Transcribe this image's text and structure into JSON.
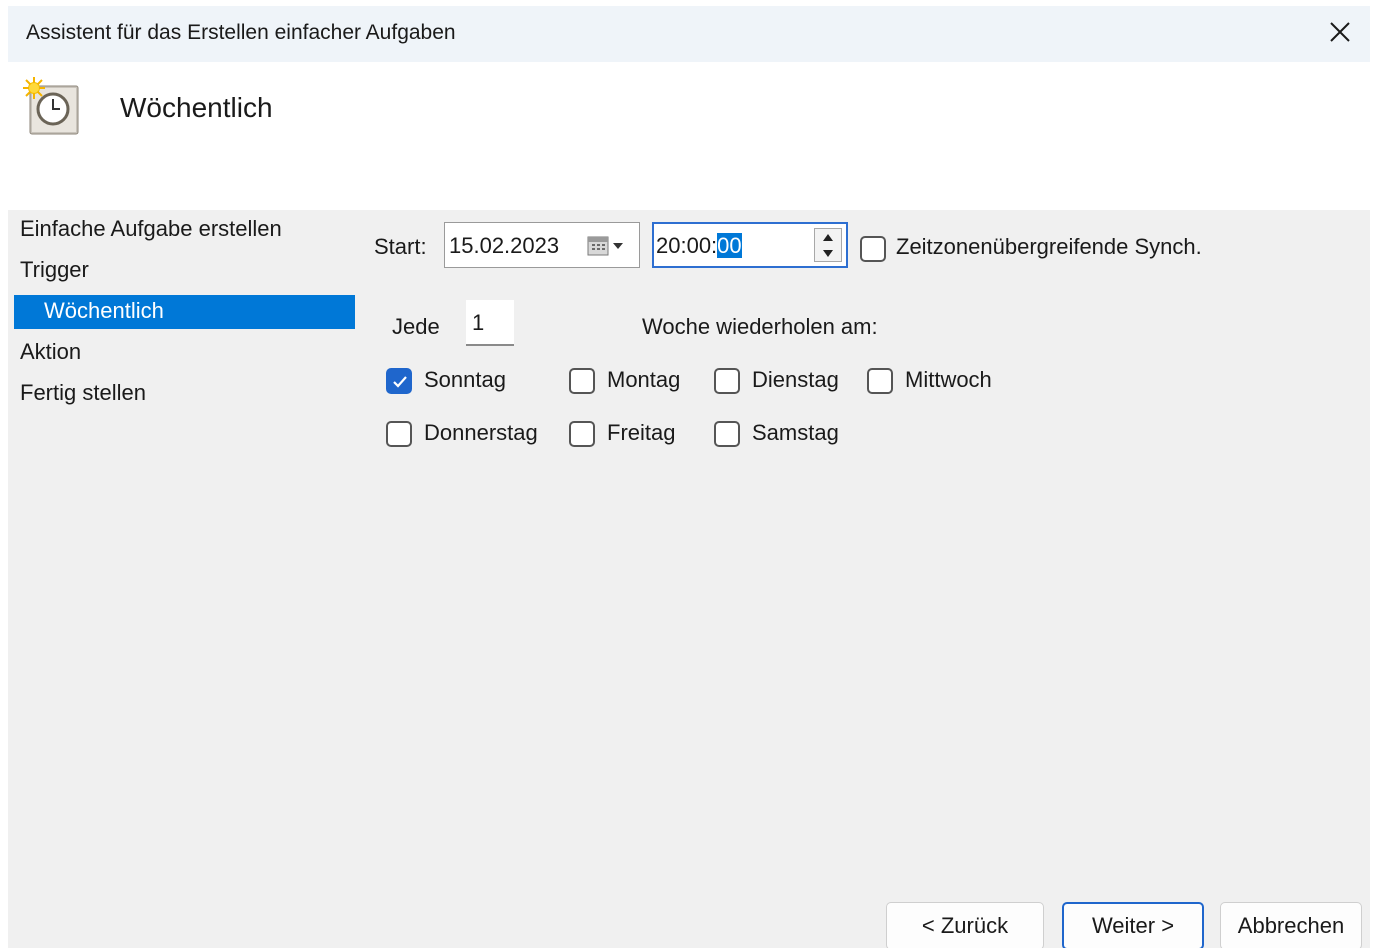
{
  "window": {
    "title": "Assistent für das Erstellen einfacher Aufgaben"
  },
  "header": {
    "icon": "task-scheduler-clock-icon",
    "heading": "Wöchentlich"
  },
  "nav": {
    "items": [
      {
        "label": "Einfache Aufgabe erstellen",
        "selected": false
      },
      {
        "label": "Trigger",
        "selected": false
      },
      {
        "label": "Wöchentlich",
        "selected": true
      },
      {
        "label": "Aktion",
        "selected": false
      },
      {
        "label": "Fertig stellen",
        "selected": false
      }
    ]
  },
  "form": {
    "start_label": "Start:",
    "date_value": "15.02.2023",
    "time_value_prefix": "20:00:",
    "time_value_selected": "00",
    "sync_label": "Zeitzonenübergreifende Synch.",
    "sync_checked": false,
    "every_label": "Jede",
    "every_value": "1",
    "repeat_label": "Woche wiederholen am:",
    "days": [
      {
        "label": "Sonntag",
        "checked": true
      },
      {
        "label": "Montag",
        "checked": false
      },
      {
        "label": "Dienstag",
        "checked": false
      },
      {
        "label": "Mittwoch",
        "checked": false
      },
      {
        "label": "Donnerstag",
        "checked": false
      },
      {
        "label": "Freitag",
        "checked": false
      },
      {
        "label": "Samstag",
        "checked": false
      }
    ]
  },
  "buttons": {
    "back": "< Zurück",
    "next": "Weiter >",
    "cancel": "Abbrechen"
  },
  "colors": {
    "accent": "#0078d7",
    "checkbox": "#1f66cc",
    "titlebar": "#eff4f9",
    "body": "#f0f0f0"
  }
}
